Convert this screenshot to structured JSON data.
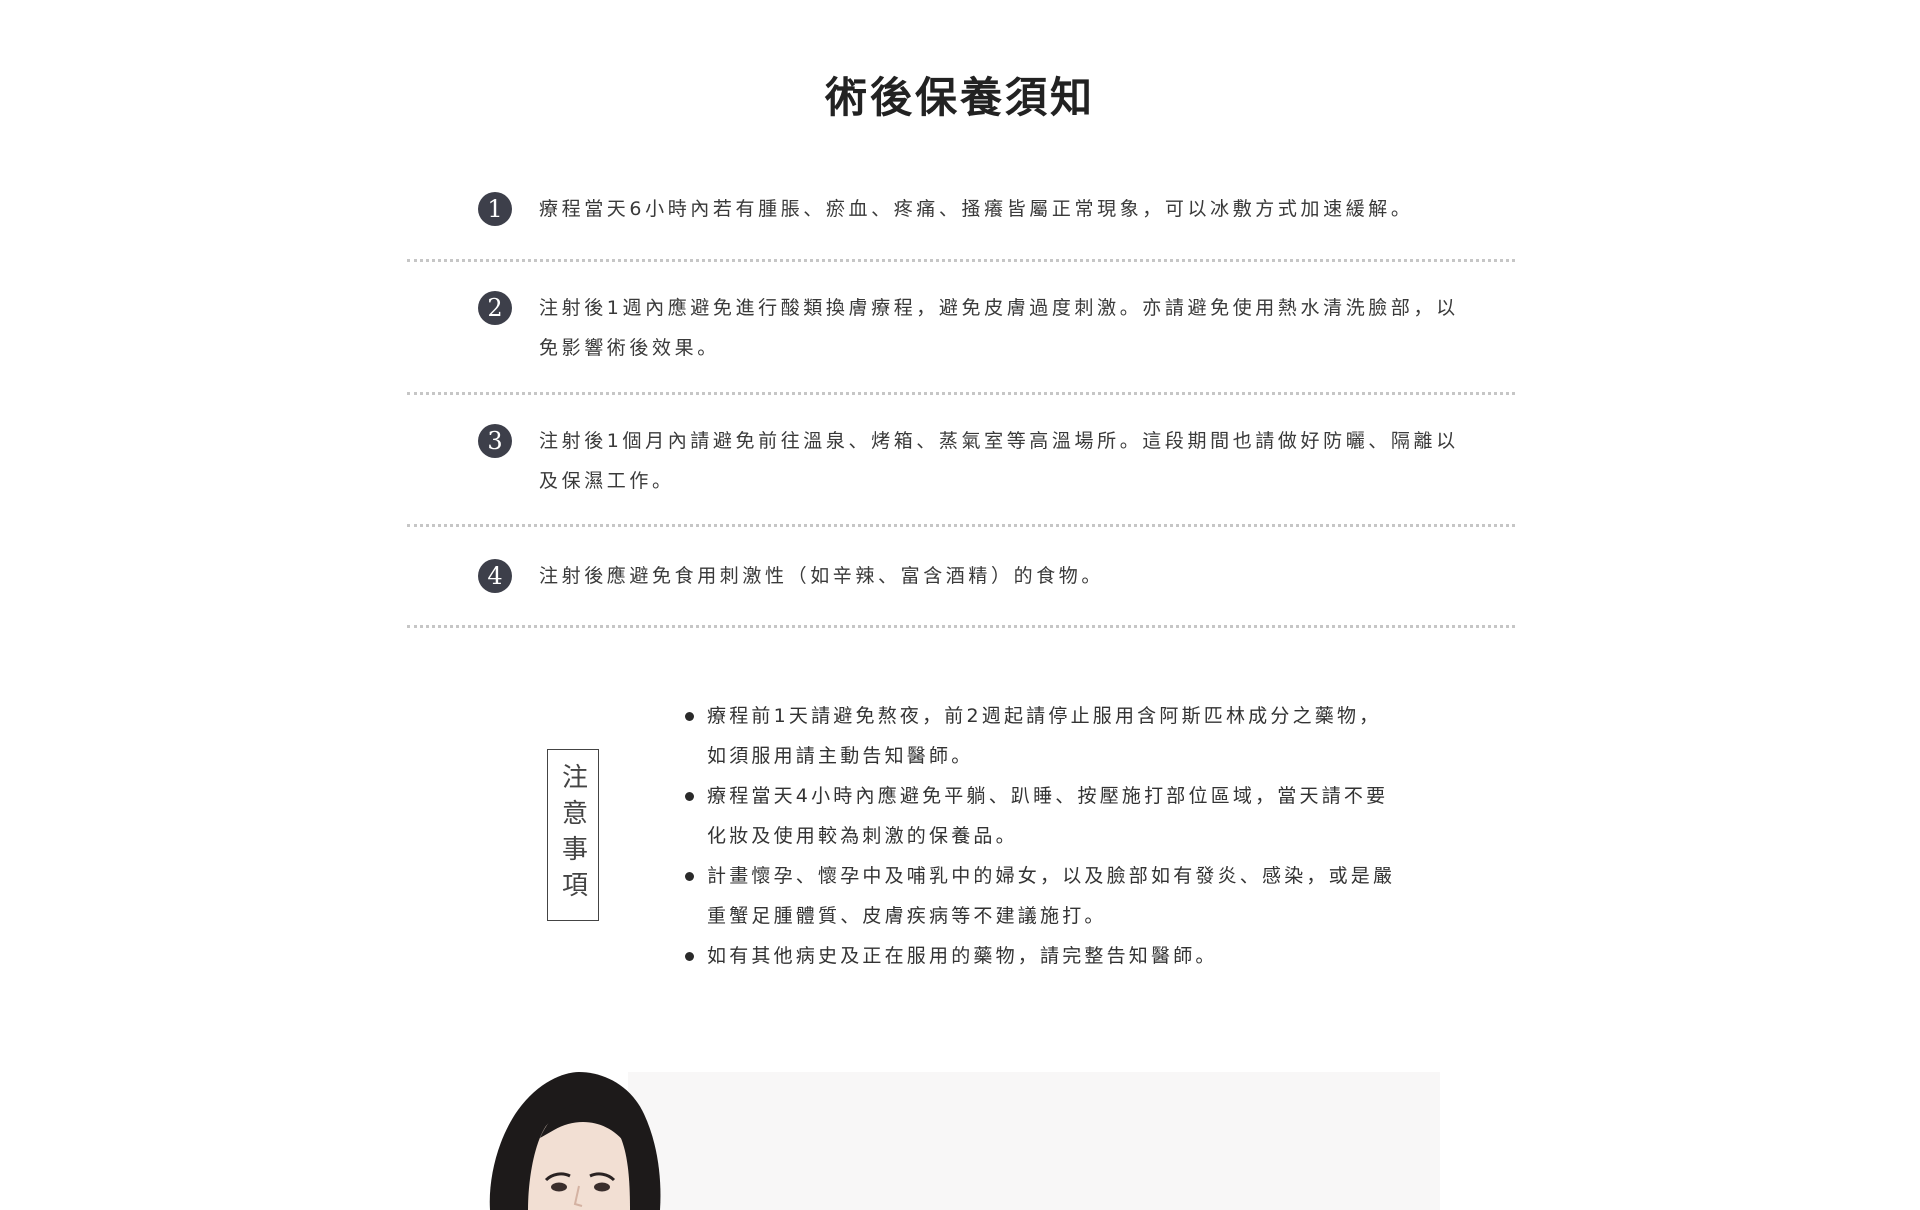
{
  "page": {
    "title": "術後保養須知"
  },
  "steps": [
    {
      "num": "1",
      "text": "療程當天6小時內若有腫脹、瘀血、疼痛、搔癢皆屬正常現象，可以冰敷方式加速緩解。"
    },
    {
      "num": "2",
      "text": "注射後1週內應避免進行酸類換膚療程，避免皮膚過度刺激。亦請避免使用熱水清洗臉部，以免影響術後效果。"
    },
    {
      "num": "3",
      "text": "注射後1個月內請避免前往溫泉、烤箱、蒸氣室等高溫場所。這段期間也請做好防曬、隔離以及保濕工作。"
    },
    {
      "num": "4",
      "text": "注射後應避免食用刺激性（如辛辣、富含酒精）的食物。"
    }
  ],
  "notice": {
    "label": "注意事項",
    "items": [
      "療程前1天請避免熬夜，前2週起請停止服用含阿斯匹林成分之藥物，如須服用請主動告知醫師。",
      "療程當天4小時內應避免平躺、趴睡、按壓施打部位區域，當天請不要化妝及使用較為刺激的保養品。",
      "計畫懷孕、懷孕中及哺乳中的婦女，以及臉部如有發炎、感染，或是嚴重蟹足腫體質、皮膚疾病等不建議施打。",
      "如有其他病史及正在服用的藥物，請完整告知醫師。"
    ]
  },
  "colors": {
    "badge": "#3d3f4a",
    "text": "#3a3a3a",
    "divider": "#c6c6c6"
  }
}
